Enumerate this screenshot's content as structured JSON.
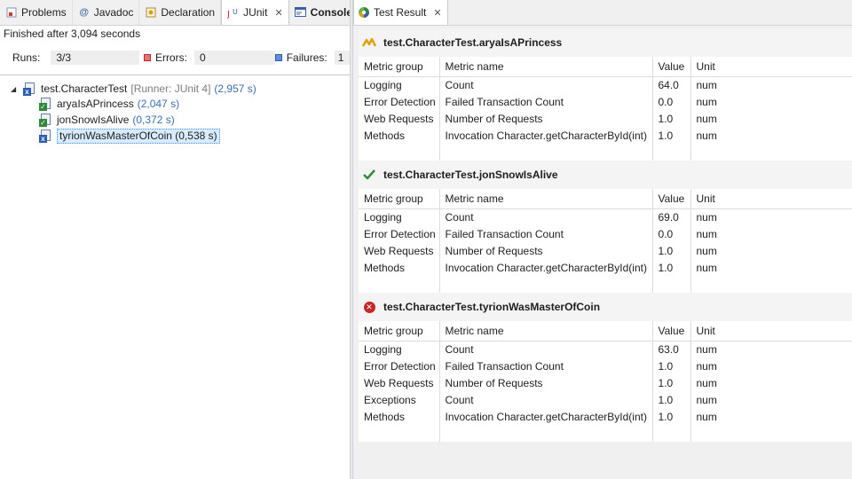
{
  "left_tabs": [
    {
      "label": "Problems",
      "icon": "problems-icon"
    },
    {
      "label": "Javadoc",
      "icon": "javadoc-icon"
    },
    {
      "label": "Declaration",
      "icon": "declaration-icon"
    },
    {
      "label": "JUnit",
      "icon": "junit-icon",
      "active": true
    },
    {
      "label": "Console",
      "icon": "console-icon"
    }
  ],
  "status": "Finished after 3,094 seconds",
  "counters": {
    "runs_label": "Runs:",
    "runs_value": "3/3",
    "errors_label": "Errors:",
    "errors_value": "0",
    "failures_label": "Failures:",
    "failures_value": "1"
  },
  "tree": {
    "root": {
      "name": "test.CharacterTest",
      "runner": "[Runner: JUnit 4]",
      "time": "(2,957 s)"
    },
    "children": [
      {
        "name": "aryaIsAPrincess",
        "time": "(2,047 s)",
        "status": "passed"
      },
      {
        "name": "jonSnowIsAlive",
        "time": "(0,372 s)",
        "status": "passed"
      },
      {
        "name": "tyrionWasMasterOfCoin",
        "time": "(0,538 s)",
        "status": "failed",
        "selected": true
      }
    ]
  },
  "right_tab": {
    "label": "Test Result",
    "icon": "test-result-icon"
  },
  "columns": {
    "group": "Metric group",
    "name": "Metric name",
    "value": "Value",
    "unit": "Unit"
  },
  "sections": [
    {
      "title": "test.CharacterTest.aryaIsAPrincess",
      "status_icon": "warning-icon",
      "rows": [
        {
          "group": "Logging",
          "name": "Count",
          "value": "64.0",
          "unit": "num"
        },
        {
          "group": "Error Detection",
          "name": "Failed Transaction Count",
          "value": "0.0",
          "unit": "num"
        },
        {
          "group": "Web Requests",
          "name": "Number of Requests",
          "value": "1.0",
          "unit": "num"
        },
        {
          "group": "Methods",
          "name": "Invocation Character.getCharacterById(int)",
          "value": "1.0",
          "unit": "num"
        }
      ]
    },
    {
      "title": "test.CharacterTest.jonSnowIsAlive",
      "status_icon": "check-icon",
      "rows": [
        {
          "group": "Logging",
          "name": "Count",
          "value": "69.0",
          "unit": "num"
        },
        {
          "group": "Error Detection",
          "name": "Failed Transaction Count",
          "value": "0.0",
          "unit": "num"
        },
        {
          "group": "Web Requests",
          "name": "Number of Requests",
          "value": "1.0",
          "unit": "num"
        },
        {
          "group": "Methods",
          "name": "Invocation Character.getCharacterById(int)",
          "value": "1.0",
          "unit": "num"
        }
      ]
    },
    {
      "title": "test.CharacterTest.tyrionWasMasterOfCoin",
      "status_icon": "error-icon",
      "rows": [
        {
          "group": "Logging",
          "name": "Count",
          "value": "63.0",
          "unit": "num"
        },
        {
          "group": "Error Detection",
          "name": "Failed Transaction Count",
          "value": "1.0",
          "unit": "num"
        },
        {
          "group": "Web Requests",
          "name": "Number of Requests",
          "value": "1.0",
          "unit": "num"
        },
        {
          "group": "Exceptions",
          "name": "Count",
          "value": "1.0",
          "unit": "num"
        },
        {
          "group": "Methods",
          "name": "Invocation Character.getCharacterById(int)",
          "value": "1.0",
          "unit": "num"
        }
      ]
    }
  ]
}
